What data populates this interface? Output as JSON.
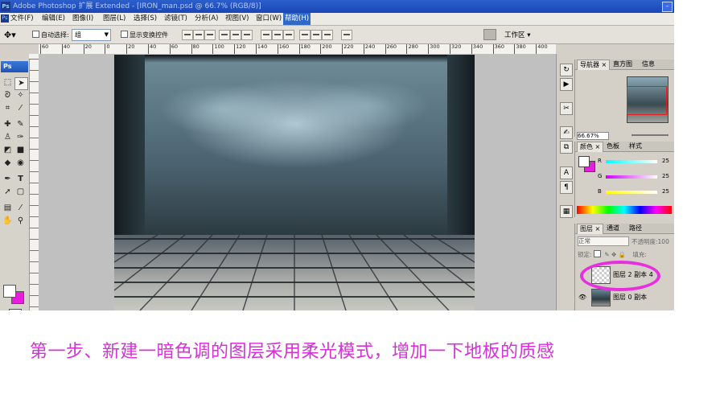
{
  "window": {
    "title": "Adobe Photoshop 扩展 Extended - [IRON_man.psd @ 66.7% (RGB/8)]",
    "minimize_symbol": "–"
  },
  "menu": {
    "app_icon": "Ps",
    "items": [
      "文件(F)",
      "编辑(E)",
      "图像(I)",
      "图层(L)",
      "选择(S)",
      "滤镜(T)",
      "分析(A)",
      "视图(V)",
      "窗口(W)",
      "帮助(H)"
    ],
    "active_index": 9
  },
  "options": {
    "auto_select_label": "自动选择:",
    "auto_select_value": "组",
    "show_transform_label": "显示变换控件",
    "workspace_label": "工作区 ▾"
  },
  "ruler": {
    "ticks": [
      "60",
      "40",
      "20",
      "0",
      "20",
      "40",
      "60",
      "80",
      "100",
      "120",
      "140",
      "160",
      "180",
      "200",
      "220",
      "240",
      "260",
      "280",
      "300",
      "320",
      "340",
      "360",
      "380",
      "400"
    ]
  },
  "toolbox": {
    "logo": "Ps",
    "fg_color": "#ffffff",
    "bg_color": "#e81cde"
  },
  "navigator": {
    "tabs": [
      "导航器 ×",
      "直方图",
      "信息"
    ],
    "zoom_value": "66.67%"
  },
  "color_panel": {
    "tabs": [
      "颜色 ×",
      "色板",
      "样式"
    ],
    "channels": [
      {
        "label": "R",
        "value": "25"
      },
      {
        "label": "G",
        "value": "25"
      },
      {
        "label": "B",
        "value": "25"
      }
    ]
  },
  "layers_panel": {
    "tabs": [
      "图层 ×",
      "通道",
      "路径"
    ],
    "blend_mode": "正常",
    "opacity_label": "不透明度:",
    "opacity_value": "100",
    "lock_label": "锁定:",
    "fill_label": "填充:",
    "layers": [
      {
        "name": "图层 2 副本 4",
        "visible": false,
        "highlighted": true
      },
      {
        "name": "图层 0 副本",
        "visible": true,
        "highlighted": false
      }
    ]
  },
  "caption": "第一步、新建一暗色调的图层采用柔光模式，增加一下地板的质感",
  "colors": {
    "accent": "#d431d6",
    "highlight_oval": "#e82fe0",
    "titlebar": "#1f4fbd"
  }
}
